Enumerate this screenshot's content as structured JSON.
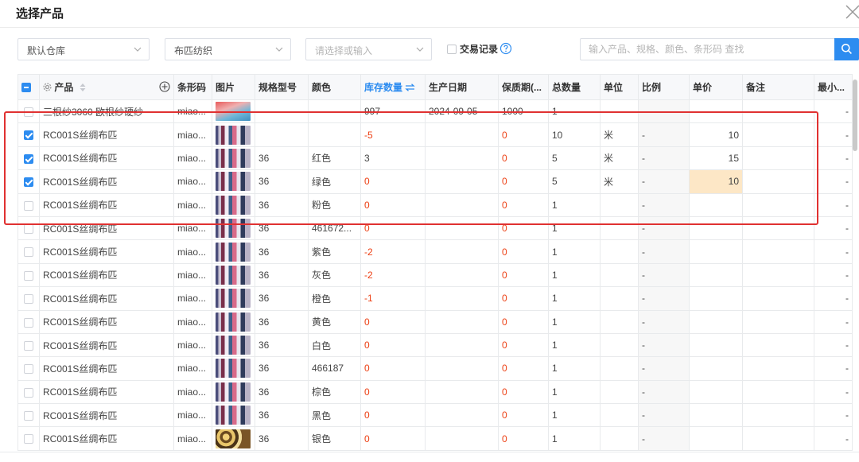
{
  "dialog": {
    "title": "选择产品"
  },
  "filters": {
    "warehouse": "默认仓库",
    "category": "布匹纺织",
    "select_placeholder": "请选择或输入",
    "trade_record_label": "交易记录",
    "search_placeholder": "输入产品、规格、颜色、条形码 查找"
  },
  "columns": {
    "product": "产品",
    "barcode": "条形码",
    "image": "图片",
    "spec": "规格型号",
    "color": "颜色",
    "stock": "库存数量",
    "prod_date": "生产日期",
    "shelf_life": "保质期(...",
    "total": "总数量",
    "unit": "单位",
    "ratio": "比例",
    "price": "单价",
    "note": "备注",
    "min": "最小..."
  },
  "rows": [
    {
      "product": "三根纱3060 欧根纱硬纱",
      "barcode": "miao...",
      "image": "flame",
      "spec": "",
      "color": "",
      "stock": "997",
      "prod_date": "2024-09-05",
      "shelf_life": "1000",
      "total": "1",
      "unit": "",
      "ratio": "",
      "price": "",
      "note": "",
      "min": "-",
      "checked": false
    },
    {
      "product": "RC001S丝绸布匹",
      "barcode": "miao...",
      "image": "fabric",
      "spec": "",
      "color": "",
      "stock": "-5",
      "prod_date": "",
      "shelf_life": "0",
      "total": "10",
      "unit": "米",
      "ratio": "-",
      "price": "10",
      "note": "",
      "min": "-",
      "checked": true
    },
    {
      "product": "RC001S丝绸布匹",
      "barcode": "miao...",
      "image": "fabric",
      "spec": "36",
      "color": "红色",
      "stock": "3",
      "prod_date": "",
      "shelf_life": "0",
      "total": "5",
      "unit": "米",
      "ratio": "-",
      "price": "15",
      "note": "",
      "min": "-",
      "checked": true
    },
    {
      "product": "RC001S丝绸布匹",
      "barcode": "miao...",
      "image": "fabric",
      "spec": "36",
      "color": "绿色",
      "stock": "0",
      "prod_date": "",
      "shelf_life": "0",
      "total": "5",
      "unit": "米",
      "ratio": "-",
      "price": "10",
      "note": "",
      "min": "-",
      "checked": true
    },
    {
      "product": "RC001S丝绸布匹",
      "barcode": "miao...",
      "image": "fabric",
      "spec": "36",
      "color": "粉色",
      "stock": "0",
      "prod_date": "",
      "shelf_life": "0",
      "total": "1",
      "unit": "",
      "ratio": "-",
      "price": "",
      "note": "",
      "min": "-",
      "checked": false
    },
    {
      "product": "RC001S丝绸布匹",
      "barcode": "miao...",
      "image": "fabric",
      "spec": "36",
      "color": "461672...",
      "stock": "0",
      "prod_date": "",
      "shelf_life": "0",
      "total": "1",
      "unit": "",
      "ratio": "-",
      "price": "",
      "note": "",
      "min": "-",
      "checked": false
    },
    {
      "product": "RC001S丝绸布匹",
      "barcode": "miao...",
      "image": "fabric",
      "spec": "36",
      "color": "紫色",
      "stock": "-2",
      "prod_date": "",
      "shelf_life": "0",
      "total": "1",
      "unit": "",
      "ratio": "-",
      "price": "",
      "note": "",
      "min": "-",
      "checked": false
    },
    {
      "product": "RC001S丝绸布匹",
      "barcode": "miao...",
      "image": "fabric",
      "spec": "36",
      "color": "灰色",
      "stock": "-2",
      "prod_date": "",
      "shelf_life": "0",
      "total": "1",
      "unit": "",
      "ratio": "-",
      "price": "",
      "note": "",
      "min": "-",
      "checked": false
    },
    {
      "product": "RC001S丝绸布匹",
      "barcode": "miao...",
      "image": "fabric",
      "spec": "36",
      "color": "橙色",
      "stock": "-1",
      "prod_date": "",
      "shelf_life": "0",
      "total": "1",
      "unit": "",
      "ratio": "-",
      "price": "",
      "note": "",
      "min": "-",
      "checked": false
    },
    {
      "product": "RC001S丝绸布匹",
      "barcode": "miao...",
      "image": "fabric",
      "spec": "36",
      "color": "黄色",
      "stock": "0",
      "prod_date": "",
      "shelf_life": "0",
      "total": "1",
      "unit": "",
      "ratio": "-",
      "price": "",
      "note": "",
      "min": "-",
      "checked": false
    },
    {
      "product": "RC001S丝绸布匹",
      "barcode": "miao...",
      "image": "fabric",
      "spec": "36",
      "color": "白色",
      "stock": "0",
      "prod_date": "",
      "shelf_life": "0",
      "total": "1",
      "unit": "",
      "ratio": "-",
      "price": "",
      "note": "",
      "min": "-",
      "checked": false
    },
    {
      "product": "RC001S丝绸布匹",
      "barcode": "miao...",
      "image": "fabric",
      "spec": "36",
      "color": "466187",
      "stock": "0",
      "prod_date": "",
      "shelf_life": "0",
      "total": "1",
      "unit": "",
      "ratio": "-",
      "price": "",
      "note": "",
      "min": "-",
      "checked": false
    },
    {
      "product": "RC001S丝绸布匹",
      "barcode": "miao...",
      "image": "fabric",
      "spec": "36",
      "color": "棕色",
      "stock": "0",
      "prod_date": "",
      "shelf_life": "0",
      "total": "1",
      "unit": "",
      "ratio": "-",
      "price": "",
      "note": "",
      "min": "-",
      "checked": false
    },
    {
      "product": "RC001S丝绸布匹",
      "barcode": "miao...",
      "image": "fabric",
      "spec": "36",
      "color": "黑色",
      "stock": "0",
      "prod_date": "",
      "shelf_life": "0",
      "total": "1",
      "unit": "",
      "ratio": "-",
      "price": "",
      "note": "",
      "min": "-",
      "checked": false
    },
    {
      "product": "RC001S丝绸布匹",
      "barcode": "miao...",
      "image": "gold",
      "spec": "36",
      "color": "银色",
      "stock": "0",
      "prod_date": "",
      "shelf_life": "0",
      "total": "1",
      "unit": "",
      "ratio": "-",
      "price": "",
      "note": "",
      "min": "-",
      "checked": false
    }
  ],
  "colors": {
    "accent": "#2d8cf0",
    "negative": "#ed4014",
    "highlight": "#fde7c6",
    "selection_outline": "#e03131"
  }
}
